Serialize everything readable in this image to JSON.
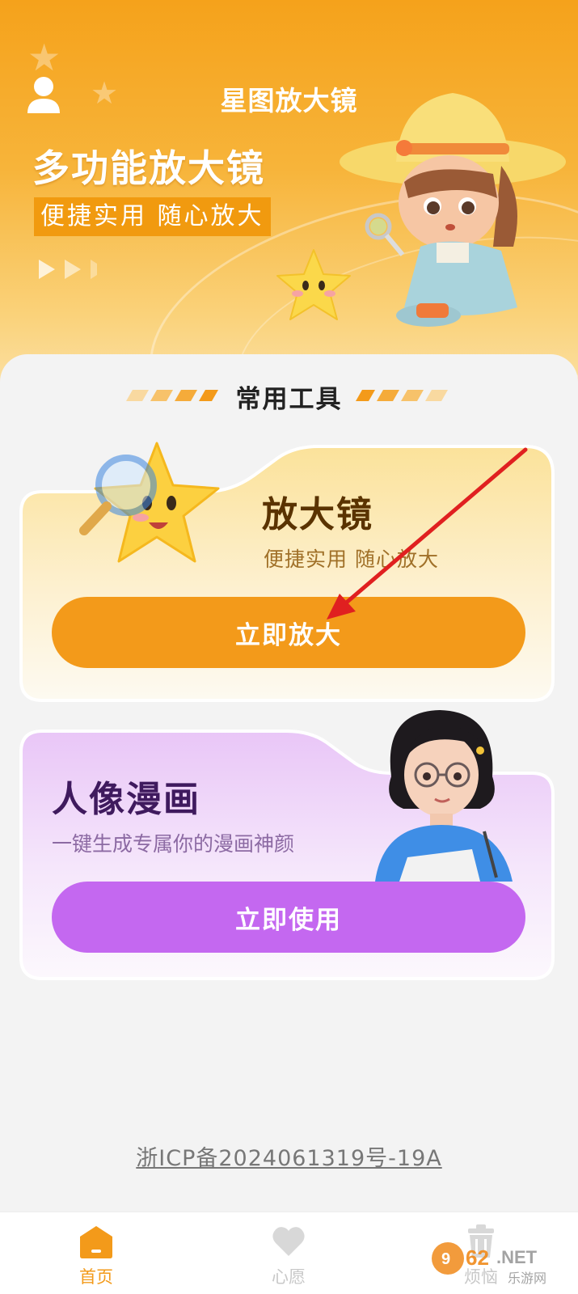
{
  "header": {
    "app_title": "星图放大镜",
    "headline": "多功能放大镜",
    "subline": "便捷实用 随心放大"
  },
  "section": {
    "title": "常用工具"
  },
  "tools": [
    {
      "title": "放大镜",
      "description": "便捷实用 随心放大",
      "button_label": "立即放大"
    },
    {
      "title": "人像漫画",
      "description": "一键生成专属你的漫画神颜",
      "button_label": "立即使用"
    }
  ],
  "footer": {
    "icp": "浙ICP备2024061319号-19A"
  },
  "bottom_nav": {
    "items": [
      {
        "label": "首页",
        "icon": "home-icon",
        "active": true
      },
      {
        "label": "心愿",
        "icon": "heart-icon",
        "active": false
      },
      {
        "label": "烦恼",
        "icon": "trash-icon",
        "active": false
      }
    ]
  },
  "watermark": {
    "text": "962.NET",
    "sub": "乐游网"
  },
  "colors": {
    "brand_orange": "#f39a1a",
    "brand_purple": "#c468f0",
    "annotation_red": "#e02020"
  }
}
